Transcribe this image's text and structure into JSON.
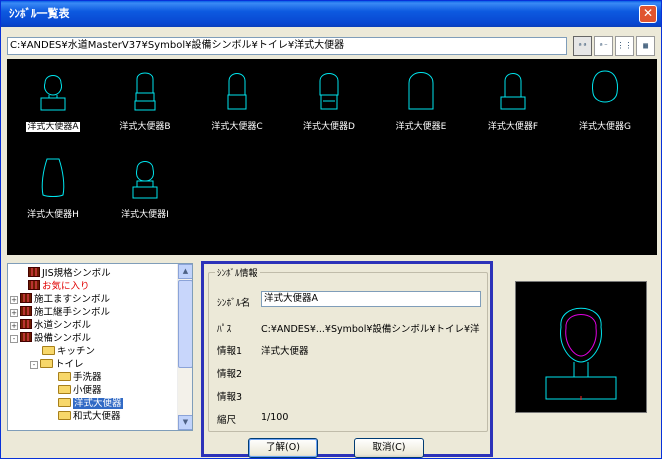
{
  "window": {
    "title": "ｼﾝﾎﾞﾙ一覧表",
    "close_glyph": "✕"
  },
  "path": "C:¥ANDES¥水道MasterV37¥Symbol¥設備シンボル¥トイレ¥洋式大便器",
  "view_buttons": [
    {
      "name": "large-icon-view",
      "glyph": "ᵃᵃ"
    },
    {
      "name": "small-icon-view",
      "glyph": "ᵃ⁻"
    },
    {
      "name": "list-view",
      "glyph": "⋮⋮"
    },
    {
      "name": "detail-view",
      "glyph": "▦"
    }
  ],
  "symbols": [
    {
      "label": "洋式大便器A"
    },
    {
      "label": "洋式大便器B"
    },
    {
      "label": "洋式大便器C"
    },
    {
      "label": "洋式大便器D"
    },
    {
      "label": "洋式大便器E"
    },
    {
      "label": "洋式大便器F"
    },
    {
      "label": "洋式大便器G"
    },
    {
      "label": "洋式大便器H"
    },
    {
      "label": "洋式大便器I"
    }
  ],
  "tree": [
    {
      "label": "JIS規格シンボル",
      "icon": "book-icon"
    },
    {
      "label": "お気に入り",
      "icon": "book-icon",
      "color": "#e00000"
    },
    {
      "label": "施工ますシンボル",
      "icon": "book-icon",
      "toggle": "+"
    },
    {
      "label": "施工継手シンボル",
      "icon": "book-icon",
      "toggle": "+"
    },
    {
      "label": "水道シンボル",
      "icon": "book-icon",
      "toggle": "+"
    },
    {
      "label": "設備シンボル",
      "icon": "book-icon",
      "toggle": "-"
    },
    {
      "label": "キッチン",
      "icon": "folder-icon"
    },
    {
      "label": "トイレ",
      "icon": "folder-icon",
      "toggle": "-"
    },
    {
      "label": "手洗器",
      "icon": "folder-icon"
    },
    {
      "label": "小便器",
      "icon": "folder-icon"
    },
    {
      "label": "洋式大便器",
      "icon": "folder-icon",
      "selected": true
    },
    {
      "label": "和式大便器",
      "icon": "folder-icon"
    }
  ],
  "info": {
    "group_title": "ｼﾝﾎﾞﾙ情報",
    "name_label": "ｼﾝﾎﾞﾙ名",
    "name_value": "洋式大便器A",
    "path_label": "ﾊﾟｽ",
    "path_value": "C:¥ANDES¥...¥Symbol¥設備シンボル¥トイレ¥洋",
    "info1_label": "情報1",
    "info1_value": "洋式大便器",
    "info2_label": "情報2",
    "info3_label": "情報3",
    "scale_label": "縮尺",
    "scale_value": "1/100",
    "ok_label": "了解(O)",
    "cancel_label": "取消(C)"
  },
  "colors": {
    "symbol_line": "#00e5ee",
    "selection": "#316ac5",
    "highlight_border": "#2c32b9"
  }
}
